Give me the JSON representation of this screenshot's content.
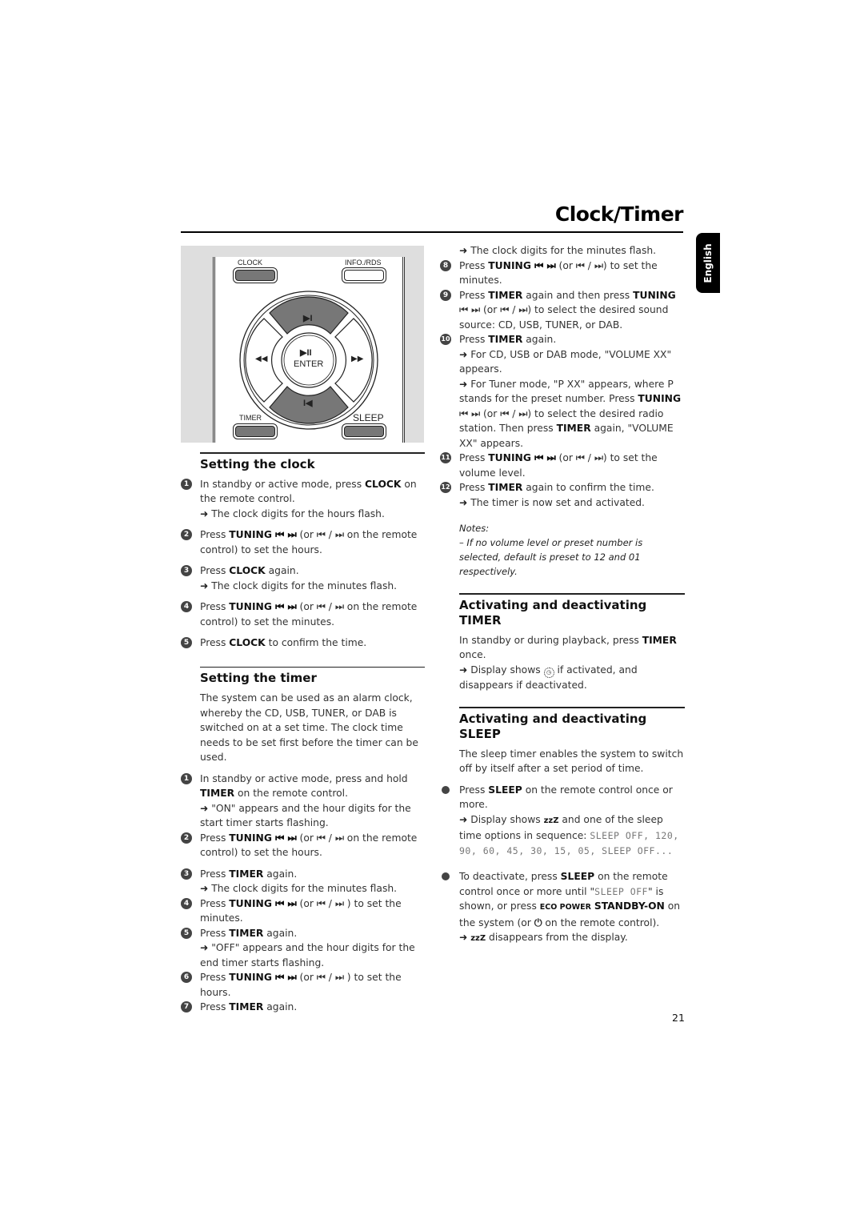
{
  "header": {
    "title": "Clock/Timer",
    "language_tab": "English"
  },
  "remote": {
    "clock": "CLOCK",
    "info": "INFO./RDS",
    "enter": "ENTER",
    "timer": "TIMER",
    "sleep": "SLEEP",
    "up_icon": "▶I",
    "play_pause_icon": "▶II",
    "rewind_icon": "◀◀",
    "forward_icon": "▶▶",
    "down_icon": "I◀"
  },
  "setting_clock": {
    "title": "Setting the clock",
    "steps": [
      {
        "n": "1",
        "pre": "In standby or active mode, press ",
        "bold": "CLOCK",
        "post": " on the remote control.",
        "result": "The clock digits for the hours flash."
      },
      {
        "n": "2",
        "pre": "Press ",
        "bold": "TUNING ⏮ ⏭",
        "post": " (or ⏮ / ⏭ on the remote control) to set the hours."
      },
      {
        "n": "3",
        "pre": "Press ",
        "bold": "CLOCK",
        "post": " again.",
        "result": "The clock digits for the minutes flash."
      },
      {
        "n": "4",
        "pre": "Press ",
        "bold": "TUNING ⏮ ⏭",
        "post": " (or ⏮ / ⏭ on the remote control) to set the minutes."
      },
      {
        "n": "5",
        "pre": "Press ",
        "bold": "CLOCK",
        "post": " to confirm the time."
      }
    ]
  },
  "setting_timer": {
    "title": "Setting the timer",
    "intro": "The system can be used as an alarm clock, whereby the CD, USB, TUNER, or DAB is switched on at a set time. The clock time needs to be set first before the timer can be used.",
    "steps": [
      {
        "n": "1",
        "pre": "In standby or active mode, press and hold ",
        "bold": "TIMER",
        "post": " on the remote control.",
        "result": "\"ON\" appears and the hour digits for the start timer starts flashing."
      },
      {
        "n": "2",
        "pre": "Press ",
        "bold": "TUNING ⏮ ⏭",
        "post": " (or ⏮ / ⏭ on the remote control) to set the hours."
      },
      {
        "n": "3",
        "pre": "Press ",
        "bold": "TIMER",
        "post": " again.",
        "result": "The clock digits for the minutes flash."
      },
      {
        "n": "4",
        "pre": "Press ",
        "bold": "TUNING ⏮ ⏭",
        "post": " (or ⏮ / ⏭ ) to set the minutes."
      },
      {
        "n": "5",
        "pre": "Press ",
        "bold": "TIMER",
        "post": " again.",
        "result": "\"OFF\" appears and the hour digits for the end timer starts flashing."
      },
      {
        "n": "6",
        "pre": "Press ",
        "bold": "TUNING ⏮ ⏭",
        "post": " (or ⏮ / ⏭ ) to set the hours."
      },
      {
        "n": "7",
        "pre": "Press ",
        "bold": "TIMER",
        "post": " again."
      }
    ],
    "continued": {
      "result0": "The clock digits for the minutes flash.",
      "steps": [
        {
          "n": "8",
          "pre": "Press ",
          "bold": "TUNING ⏮ ⏭",
          "post": " (or ⏮ / ⏭) to set the minutes."
        },
        {
          "n": "9",
          "pre": "Press ",
          "bold": "TIMER",
          "mid": " again and then press ",
          "bold2": "TUNING",
          "post": " ⏮ ⏭ (or ⏮ / ⏭) to select the desired sound source: CD, USB, TUNER, or DAB."
        },
        {
          "n": "10",
          "pre": "Press ",
          "bold": "TIMER",
          "post": " again.",
          "result": "For CD, USB or DAB mode, \"VOLUME XX\" appears.",
          "result2_pre": "For Tuner mode, \"P XX\" appears, where P stands for the preset number. Press ",
          "result2_bold": "TUNING",
          "result2_mid": " ⏮ ⏭ (or ⏮ / ⏭) to select the desired radio station. Then press ",
          "result2_bold2": "TIMER",
          "result2_post": " again, \"VOLUME XX\" appears."
        },
        {
          "n": "11",
          "pre": "Press ",
          "bold": "TUNING ⏮ ⏭",
          "post": " (or ⏮ / ⏭) to set the volume level."
        },
        {
          "n": "12",
          "pre": "Press ",
          "bold": "TIMER",
          "post": " again to confirm the time.",
          "result": "The timer is now set and activated."
        }
      ]
    },
    "notes_label": "Notes:",
    "note": "–  If no volume level or preset number is selected, default is preset to 12 and 01 respectively."
  },
  "activate_timer": {
    "title1": "Activating and deactivating",
    "title2": "TIMER",
    "pre": "In standby or during playback, press ",
    "bold": "TIMER",
    "post": " once.",
    "result_pre": "Display shows ",
    "result_post": " if activated, and disappears if deactivated."
  },
  "activate_sleep": {
    "title1": "Activating and deactivating",
    "title2": "SLEEP",
    "intro": "The sleep timer enables the system to switch off by itself after a set period of time.",
    "b1_pre": "Press ",
    "b1_bold": "SLEEP",
    "b1_post": " on the remote control once or more.",
    "b1_result_pre": "Display shows ",
    "zzz": "zzZ",
    "b1_result_post": " and one of the sleep time options in sequence: ",
    "sequence": "SLEEP OFF,  120,  90, 60, 45, 30, 15, 05, SLEEP OFF...",
    "b2_pre": "To deactivate, press ",
    "b2_bold": "SLEEP",
    "b2_mid": " on the remote control once or more until \"",
    "b2_lcd": "SLEEP OFF",
    "b2_mid2": "\" is shown, or press ",
    "b2_eco": "ECO POWER",
    "b2_standby": "STANDBY-ON",
    "b2_mid3": " on the system (or ",
    "b2_post": " on the remote control).",
    "b2_result": " disappears from the display."
  },
  "footer": {
    "page_number": "21"
  }
}
